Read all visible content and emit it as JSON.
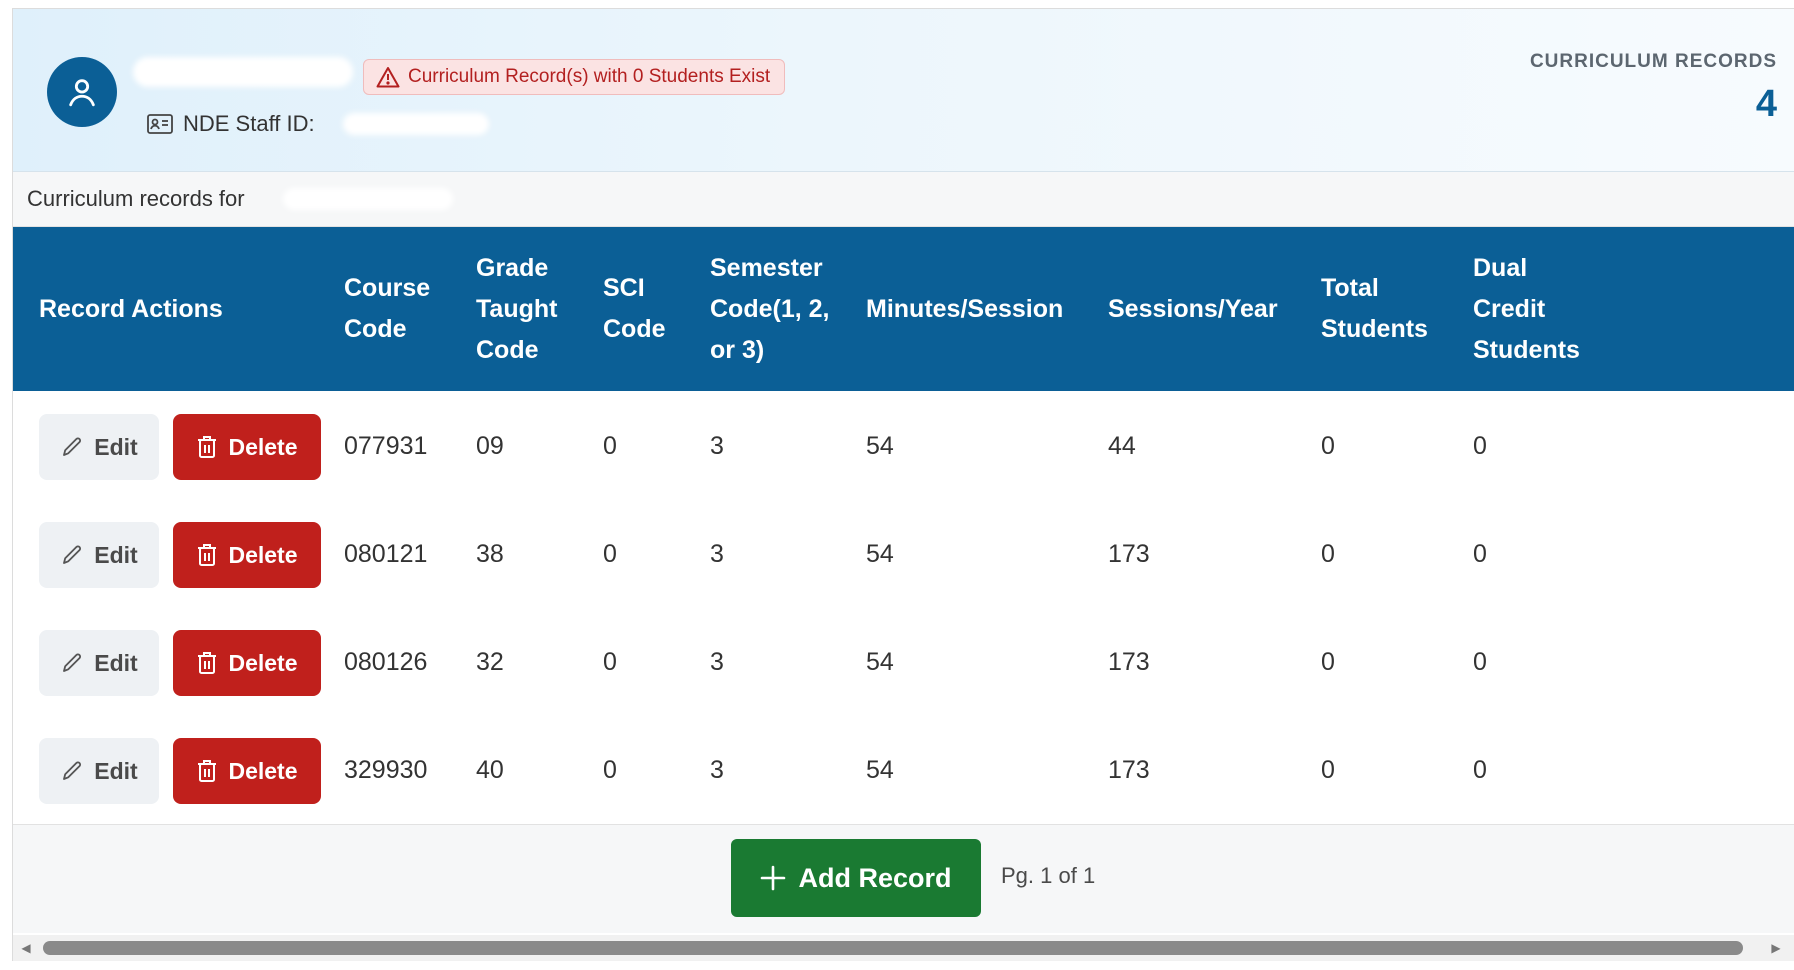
{
  "header": {
    "alert_text": "Curriculum Record(s) with 0 Students Exist",
    "staff_id_label": "NDE Staff ID:",
    "records_label": "CURRICULUM RECORDS",
    "records_count": "4"
  },
  "subtitle": "Curriculum records for",
  "columns": [
    "Record Actions",
    "Course Code",
    "Grade Taught Code",
    "SCI Code",
    "Semester Code(1, 2, or 3)",
    "Minutes/Session",
    "Sessions/Year",
    "Total Students",
    "Dual Credit Students"
  ],
  "actions": {
    "edit_label": "Edit",
    "delete_label": "Delete"
  },
  "rows": [
    {
      "course_code": "077931",
      "grade_code": "09",
      "sci_code": "0",
      "semester_code": "3",
      "minutes_session": "54",
      "sessions_year": "44",
      "total_students": "0",
      "dual_credit": "0"
    },
    {
      "course_code": "080121",
      "grade_code": "38",
      "sci_code": "0",
      "semester_code": "3",
      "minutes_session": "54",
      "sessions_year": "173",
      "total_students": "0",
      "dual_credit": "0"
    },
    {
      "course_code": "080126",
      "grade_code": "32",
      "sci_code": "0",
      "semester_code": "3",
      "minutes_session": "54",
      "sessions_year": "173",
      "total_students": "0",
      "dual_credit": "0"
    },
    {
      "course_code": "329930",
      "grade_code": "40",
      "sci_code": "0",
      "semester_code": "3",
      "minutes_session": "54",
      "sessions_year": "173",
      "total_students": "0",
      "dual_credit": "0"
    }
  ],
  "footer": {
    "add_label": "Add Record",
    "pagination": "Pg. 1 of 1"
  },
  "colors": {
    "primary": "#0b5f96",
    "danger": "#c0201c",
    "success": "#1a7a32",
    "alert_bg": "#fbe3e3"
  },
  "icons": {
    "avatar": "user-icon",
    "alert": "warning-triangle-icon",
    "staff": "id-card-icon",
    "edit": "pencil-icon",
    "delete": "trash-icon",
    "add": "plus-icon"
  }
}
